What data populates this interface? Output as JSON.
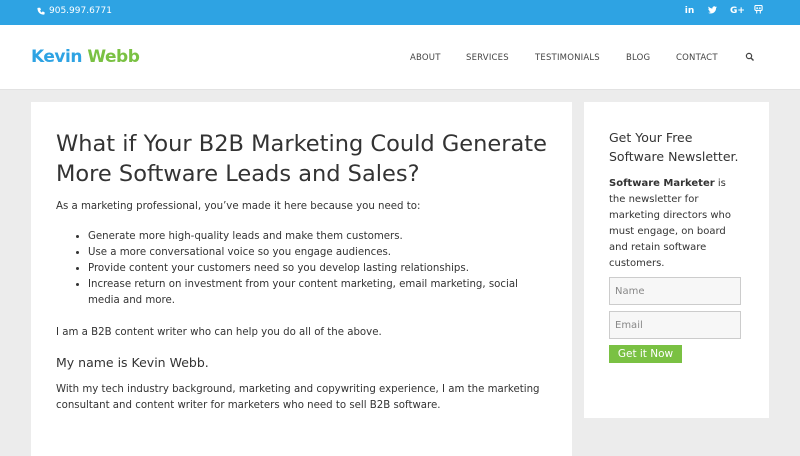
{
  "topbar": {
    "phone": "905.997.6771",
    "social": [
      {
        "icon": "linkedin-icon",
        "glyph": "in"
      },
      {
        "icon": "twitter-icon",
        "glyph": "🐦"
      },
      {
        "icon": "google-plus-icon",
        "glyph": "G+"
      },
      {
        "icon": "slideshare-icon",
        "glyph": "▣"
      }
    ]
  },
  "header": {
    "logo_first": "Kevin",
    "logo_second": "Webb",
    "nav": [
      "ABOUT",
      "SERVICES",
      "TESTIMONIALS",
      "BLOG",
      "CONTACT"
    ]
  },
  "main": {
    "title": "What if Your B2B Marketing Could Generate More Software Leads and Sales?",
    "intro": "As a marketing professional, you’ve made it here because you need to:",
    "bullets": [
      "Generate more high-quality leads and make them customers.",
      "Use a more conversational voice so you engage audiences.",
      "Provide content your customers need so you develop lasting relationships.",
      "Increase return on investment from your content marketing, email marketing, social media and more."
    ],
    "para2": "I am a B2B content writer who can help you do all of the above.",
    "subheading": "My name is Kevin Webb.",
    "para3": "With my tech industry background, marketing and copywriting experience, I am the marketing consultant and content writer for marketers who need to sell B2B software."
  },
  "sidebar": {
    "title": "Get Your Free Software Newsletter.",
    "desc_bold": "Software Marketer",
    "desc_rest": " is the newsletter for marketing directors who must engage, on board and retain software customers.",
    "name_placeholder": "Name",
    "email_placeholder": "Email",
    "button_label": "Get it Now"
  },
  "colors": {
    "accent_blue": "#2ea3e3",
    "accent_green": "#7ac143"
  }
}
